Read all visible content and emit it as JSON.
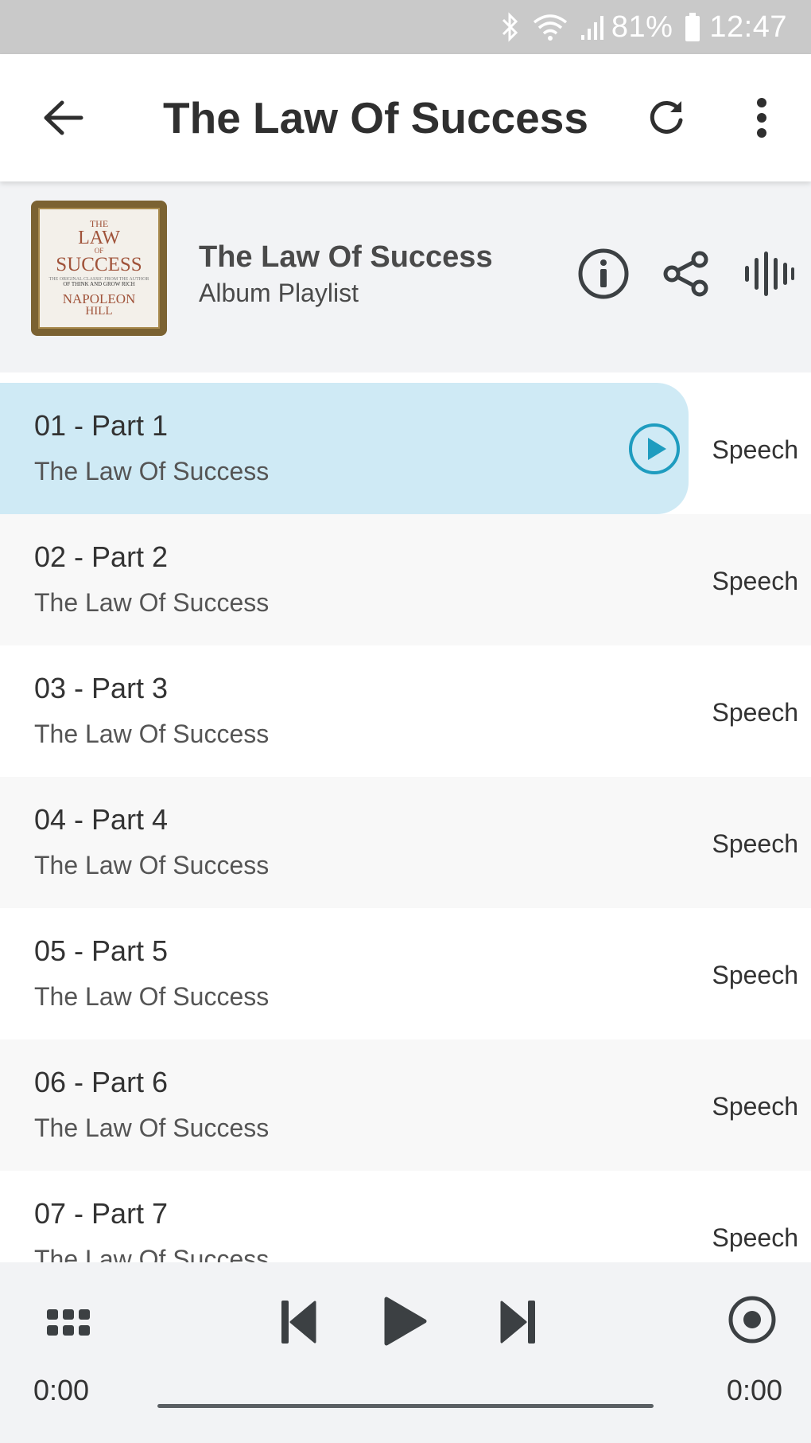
{
  "status_bar": {
    "battery": "81%",
    "time": "12:47"
  },
  "app_bar": {
    "title": "The Law Of Success"
  },
  "album": {
    "title": "The Law Of Success",
    "subtitle": "Album Playlist",
    "cover": {
      "line1": "THE",
      "line2": "LAW",
      "line3": "OF",
      "line4": "SUCCESS",
      "line5": "THE ORIGINAL CLASSIC FROM THE AUTHOR",
      "line6": "OF THINK AND GROW RICH",
      "line7": "NAPOLEON",
      "line8": "HILL"
    }
  },
  "tracks": [
    {
      "title": "01 - Part 1",
      "album": "The Law Of Success",
      "genre": "Speech",
      "playing": true
    },
    {
      "title": "02 - Part 2",
      "album": "The Law Of Success",
      "genre": "Speech"
    },
    {
      "title": "03 - Part 3",
      "album": "The Law Of Success",
      "genre": "Speech"
    },
    {
      "title": "04 - Part 4",
      "album": "The Law Of Success",
      "genre": "Speech"
    },
    {
      "title": "05 - Part 5",
      "album": "The Law Of Success",
      "genre": "Speech"
    },
    {
      "title": "06 - Part 6",
      "album": "The Law Of Success",
      "genre": "Speech"
    },
    {
      "title": "07 - Part 7",
      "album": "The Law Of Success",
      "genre": "Speech"
    }
  ],
  "player": {
    "elapsed": "0:00",
    "duration": "0:00",
    "progress": 0
  },
  "colors": {
    "accent": "#1e9cbf",
    "highlight": "#cfeaf5",
    "icon": "#3c4043"
  }
}
